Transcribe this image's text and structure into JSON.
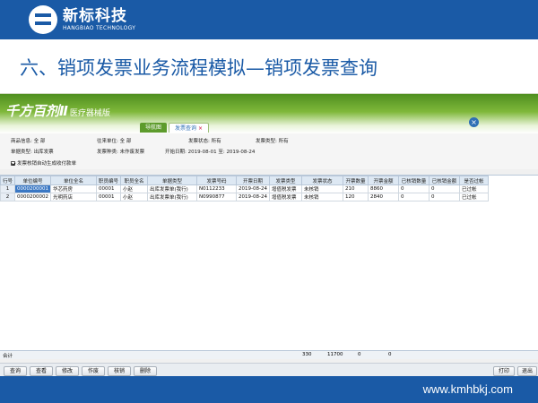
{
  "slide": {
    "logo_cn": "新标科技",
    "logo_en": "HANGBIAO TECHNOLOGY",
    "title": "六、销项发票业务流程模拟—销项发票查询",
    "footer_url": "www.kmhbkj.com"
  },
  "app": {
    "logo": "千方百剂Ⅱ",
    "logo_sub": "医疗器械版",
    "tabs": [
      {
        "label": "导航图"
      },
      {
        "label": "发票查询",
        "close": "×"
      }
    ],
    "filters": {
      "product_label": "商品信息:",
      "product_value": "全 部",
      "partner_label": "往来单位:",
      "partner_value": "全 部",
      "invoice_status_label": "发票状态:",
      "invoice_status_value": "所有",
      "invoice_type_label": "发票类型:",
      "invoice_type_value": "所有",
      "doc_type_label": "单据类型:",
      "doc_type_value": "出库发票",
      "invoice_kind_label": "发票种类:",
      "invoice_kind_value": "未作废发票",
      "date_label": "开始日期:",
      "date_start": "2019-08-01",
      "date_to": "至:",
      "date_end": "2019-08-24",
      "auto_writeoff_label": "发票核销自动生成收付款单"
    },
    "columns": [
      "行号",
      "单位编号",
      "单位全名",
      "职员编号",
      "职员全名",
      "单据类型",
      "发票号码",
      "开票日期",
      "发票类型",
      "发票状态",
      "开票数量",
      "开票金额",
      "已核销数量",
      "已核销金额",
      "是否过帐"
    ],
    "rows": [
      [
        "1",
        "0000200001",
        "华芯药房",
        "00001",
        "小赵",
        "出库发票单(我行)",
        "N0112233",
        "2019-08-24",
        "增值税发票",
        "未核销",
        "210",
        "8860",
        "0",
        "0",
        "已过帐"
      ],
      [
        "2",
        "0000200002",
        "光明药店",
        "00001",
        "小赵",
        "出库发票单(我行)",
        "N0990877",
        "2019-08-24",
        "增值税发票",
        "未核销",
        "120",
        "2840",
        "0",
        "0",
        "已过帐"
      ]
    ],
    "totals": {
      "label": "合计",
      "qty": "330",
      "amount": "11700",
      "written_qty": "0",
      "written_amount": "0"
    },
    "buttons": {
      "query": "查询",
      "view": "查看",
      "modify": "修改",
      "void": "作废",
      "writeoff": "核销",
      "delete": "删除",
      "print": "打印",
      "exit": "退出"
    }
  }
}
